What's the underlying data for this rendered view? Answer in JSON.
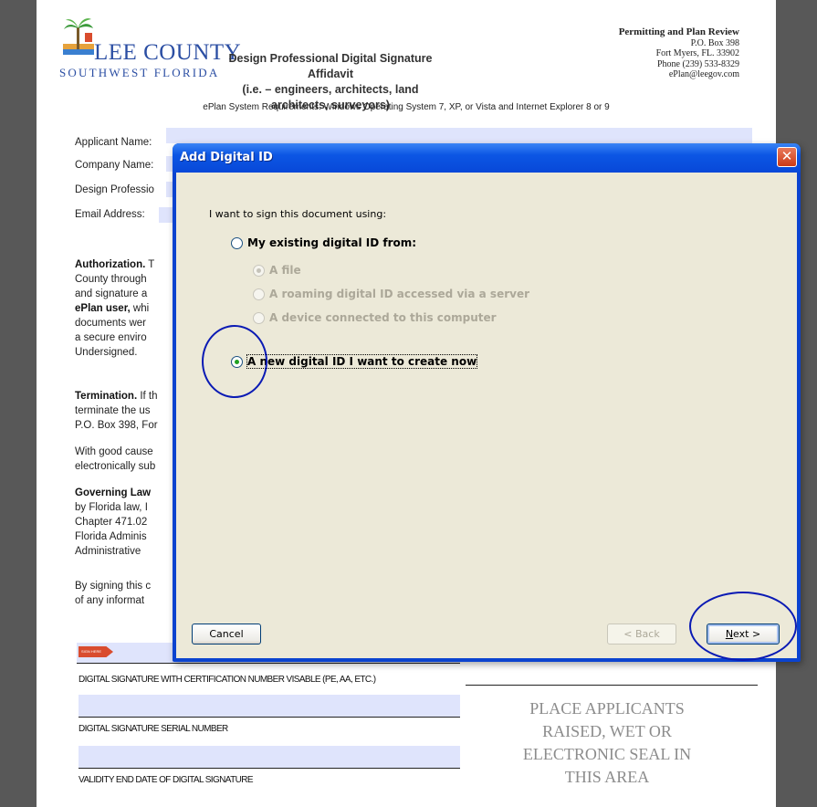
{
  "header": {
    "logo_title": "LEE COUNTY",
    "logo_subtitle": "SOUTHWEST FLORIDA",
    "doc_title_line1": "Design Professional Digital Signature Affidavit",
    "doc_title_line2": "(i.e. – engineers, architects, land architects, surveyors)",
    "contact_title": "Permitting and Plan Review",
    "contact_box": "P.O. Box 398",
    "contact_city": "Fort Myers, FL. 33902",
    "contact_phone": "Phone (239) 533-8329",
    "contact_email": "ePlan@leegov.com",
    "requirements": "ePlan System Requirements: Windows Operating System 7, XP, or Vista and Internet Explorer 8 or 9"
  },
  "form": {
    "applicant_label": "Applicant Name:",
    "company_label": "Company Name:",
    "design_label": "Design Professio",
    "email_label": "Email Address:"
  },
  "body": {
    "auth_heading": "Authorization.",
    "auth_tail": " T",
    "auth_lines": [
      "County through",
      "and signature a",
      "documents wer",
      "a secure enviro",
      "Undersigned."
    ],
    "eplan_user": "ePlan user,",
    "eplan_tail": " whi",
    "term_heading": "Termination.",
    "term_tail": " If th",
    "term_lines": [
      "terminate the us",
      "P.O. Box 398, For"
    ],
    "cause_lines": [
      "With good cause",
      "electronically sub"
    ],
    "gov_heading": "Governing Law",
    "gov_lines": [
      "by Florida law, I",
      "Chapter 471.02",
      "Florida Adminis",
      "Administrative"
    ],
    "signing_lines": [
      "By signing this c",
      "of any informat"
    ]
  },
  "signature": {
    "flag_label": "SIGN HERE",
    "sig_cert_label": "DIGITAL SIGNATURE WITH CERTIFICATION NUMBER VISABLE (PE, AA, ETC.)",
    "serial_label": "DIGITAL SIGNATURE SERIAL NUMBER",
    "validity_label": "VALIDITY END DATE OF DIGITAL SIGNATURE",
    "seal_lines": [
      "PLACE APPLICANTS",
      "RAISED, WET OR",
      "ELECTRONIC SEAL IN",
      "THIS AREA"
    ]
  },
  "dialog": {
    "title": "Add Digital ID",
    "close_glyph": "✕",
    "prompt": "I want to sign this document using:",
    "option_existing": "My existing digital ID from:",
    "sub_file": "A file",
    "sub_roaming": "A roaming digital ID accessed via a server",
    "sub_device": "A device connected to this computer",
    "option_new": "A new digital ID I want to create now",
    "selected_option": "new",
    "cancel_label": "Cancel",
    "back_label": "< Back",
    "next_label_underlined": "N",
    "next_label_rest": "ext >",
    "annotation_color": "#0a1ab4",
    "titlebar_color": "#0c56e4",
    "close_color": "#cc3a17"
  }
}
